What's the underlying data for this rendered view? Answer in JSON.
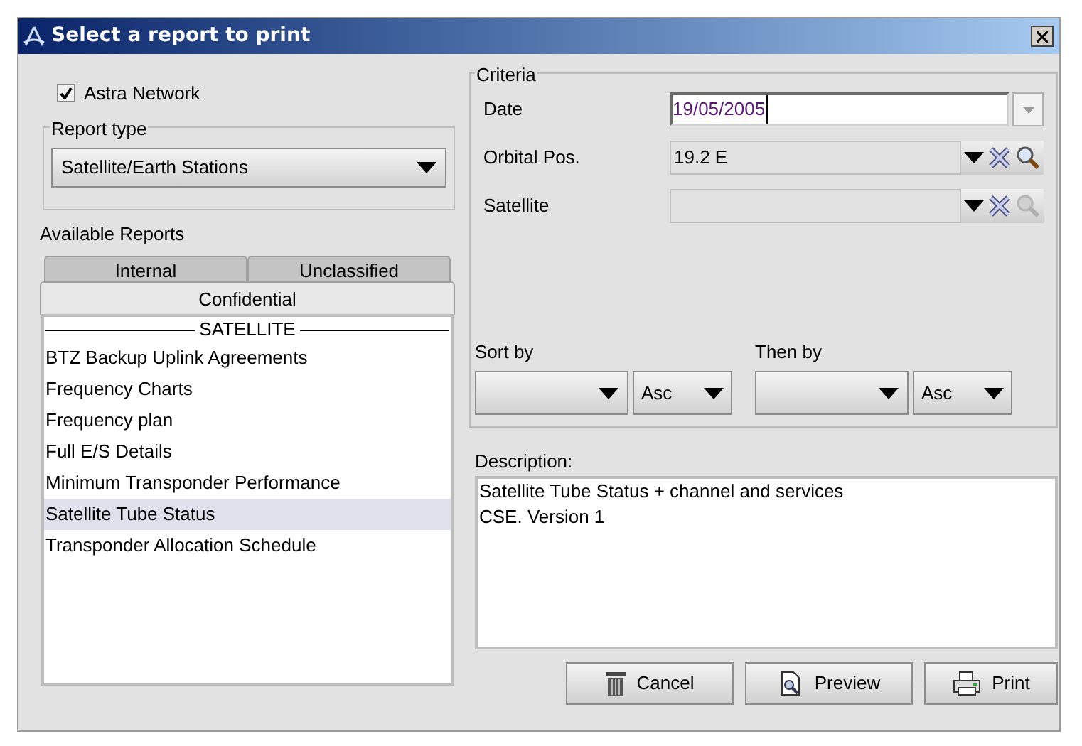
{
  "window": {
    "title": "Select a report to print"
  },
  "astra_network": {
    "label": "Astra Network",
    "checked": true
  },
  "report_type": {
    "legend": "Report type",
    "value": "Satellite/Earth Stations"
  },
  "available_reports": {
    "label": "Available Reports",
    "tabs": [
      {
        "label": "Internal",
        "selected": false
      },
      {
        "label": "Unclassified",
        "selected": false
      },
      {
        "label": "Confidential",
        "selected": true
      }
    ],
    "list_header": "SATELLITE",
    "items": [
      {
        "label": "BTZ Backup Uplink Agreements",
        "selected": false
      },
      {
        "label": "Frequency Charts",
        "selected": false
      },
      {
        "label": "Frequency plan",
        "selected": false
      },
      {
        "label": "Full E/S Details",
        "selected": false
      },
      {
        "label": "Minimum Transponder Performance",
        "selected": false
      },
      {
        "label": "Satellite Tube Status",
        "selected": true
      },
      {
        "label": "Transponder Allocation Schedule",
        "selected": false
      }
    ]
  },
  "criteria": {
    "legend": "Criteria",
    "fields": [
      {
        "kind": "date",
        "label": "Date",
        "value": "19/05/2005"
      },
      {
        "kind": "lookup",
        "label": "Orbital Pos.",
        "value": "19.2 E",
        "search_enabled": true
      },
      {
        "kind": "lookup",
        "label": "Satellite",
        "search_enabled": false
      }
    ],
    "sort": [
      {
        "label": "Sort by",
        "order": "Asc"
      },
      {
        "label": "Then by",
        "order": "Asc"
      }
    ]
  },
  "description": {
    "label": "Description:",
    "lines": [
      "Satellite Tube Status + channel and services",
      "CSE. Version 1"
    ]
  },
  "buttons": [
    {
      "kind": "cancel",
      "label": "Cancel"
    },
    {
      "kind": "preview",
      "label": "Preview"
    },
    {
      "kind": "print",
      "label": "Print"
    }
  ]
}
